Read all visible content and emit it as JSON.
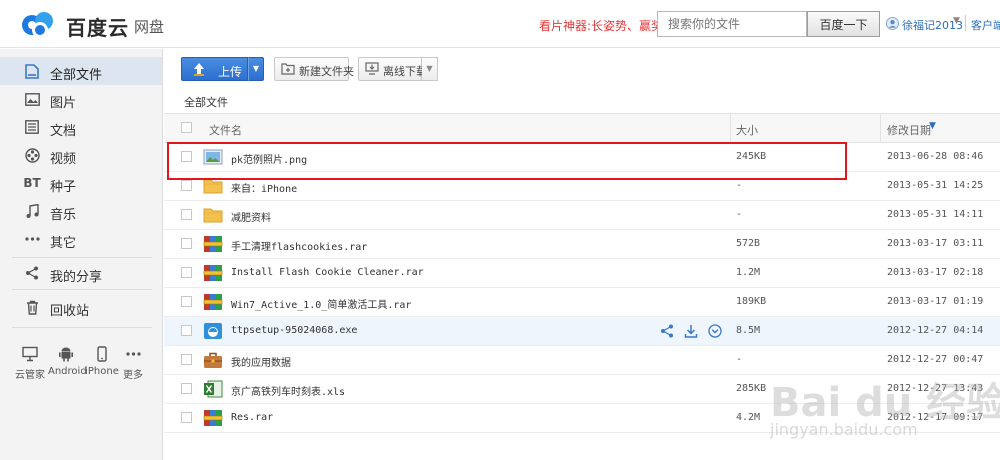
{
  "header": {
    "brand": "百度云",
    "product": "网盘",
    "promo": "看片神器:长姿势、赢奖品",
    "search_placeholder": "搜索你的文件",
    "search_button": "百度一下",
    "user_name": "徐福记2013",
    "client_link": "客户端"
  },
  "sidebar": {
    "items": [
      {
        "label": "全部文件",
        "icon": "document-icon"
      },
      {
        "label": "图片",
        "icon": "image-icon"
      },
      {
        "label": "文档",
        "icon": "list-icon"
      },
      {
        "label": "视频",
        "icon": "film-reel-icon"
      },
      {
        "label": "种子",
        "icon": "bt-icon",
        "glyph": "BT"
      },
      {
        "label": "音乐",
        "icon": "music-note-icon"
      },
      {
        "label": "其它",
        "icon": "ellipsis-icon"
      },
      {
        "label": "我的分享",
        "icon": "share-icon"
      },
      {
        "label": "回收站",
        "icon": "trash-icon"
      }
    ],
    "devices": [
      {
        "label": "云管家",
        "icon": "monitor-icon"
      },
      {
        "label": "Android",
        "icon": "android-icon"
      },
      {
        "label": "iPhone",
        "icon": "phone-icon"
      },
      {
        "label": "更多",
        "icon": "more-dots-icon"
      }
    ]
  },
  "toolbar": {
    "upload": "上传",
    "new_folder": "新建文件夹",
    "offline_download": "离线下载"
  },
  "breadcrumb": "全部文件",
  "table": {
    "columns": {
      "name": "文件名",
      "size": "大小",
      "date": "修改日期"
    },
    "rows": [
      {
        "name": "pk范例照片.png",
        "size": "245KB",
        "date": "2013-06-28 08:46",
        "type": "image"
      },
      {
        "name": "来自：iPhone",
        "size": "-",
        "date": "2013-05-31 14:25",
        "type": "folder"
      },
      {
        "name": "减肥资料",
        "size": "-",
        "date": "2013-05-31 14:11",
        "type": "folder"
      },
      {
        "name": "手工清理flashcookies.rar",
        "size": "572B",
        "date": "2013-03-17 03:11",
        "type": "archive"
      },
      {
        "name": "Install Flash Cookie Cleaner.rar",
        "size": "1.2M",
        "date": "2013-03-17 02:18",
        "type": "archive"
      },
      {
        "name": "Win7_Active_1.0_简单激活工具.rar",
        "size": "189KB",
        "date": "2013-03-17 01:19",
        "type": "archive"
      },
      {
        "name": "ttpsetup-95024068.exe",
        "size": "8.5M",
        "date": "2012-12-27 04:14",
        "type": "exe"
      },
      {
        "name": "我的应用数据",
        "size": "-",
        "date": "2012-12-27 00:47",
        "type": "app"
      },
      {
        "name": "京广高铁列车时刻表.xls",
        "size": "285KB",
        "date": "2012-12-27 13:43",
        "type": "xls"
      },
      {
        "name": "Res.rar",
        "size": "4.2M",
        "date": "2012-12-17 09:17",
        "type": "archive"
      }
    ]
  },
  "watermark": {
    "text": "Bai du 经验",
    "url": "jingyan.baidu.com"
  },
  "colors": {
    "accent": "#2c6fcf",
    "highlight": "#e3171b",
    "promo": "#e4393c",
    "link": "#2a6ebb"
  }
}
